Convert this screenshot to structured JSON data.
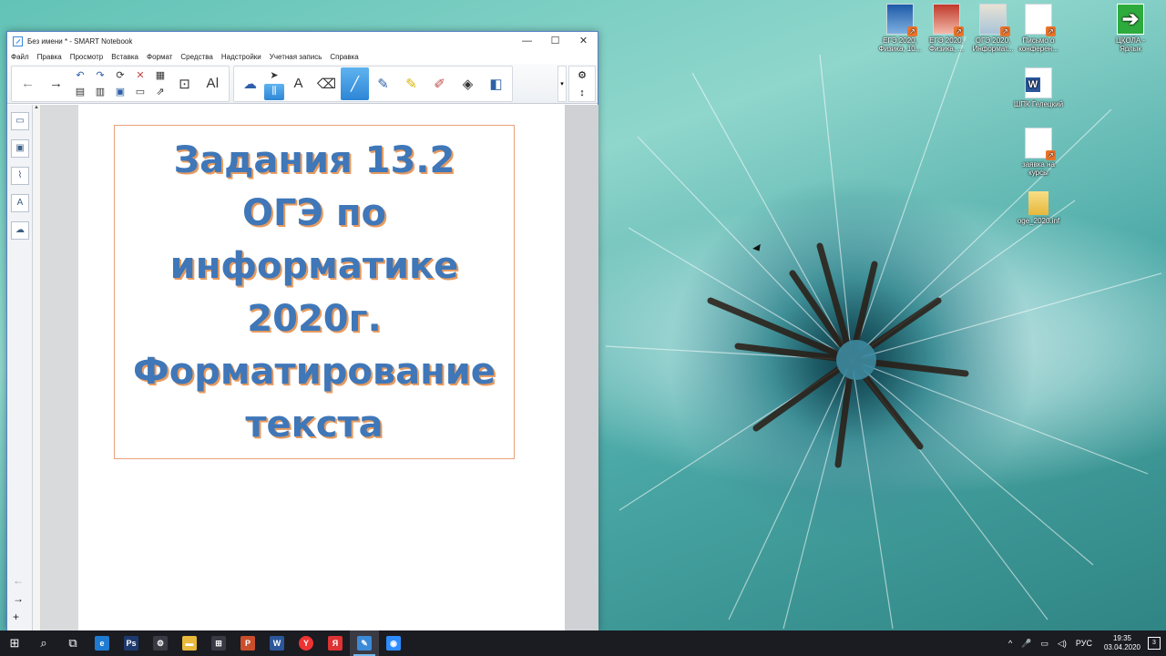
{
  "desktop": {
    "icons": [
      {
        "label": "ЕГЭ 2020, Физика, 10...",
        "kind": "book"
      },
      {
        "label": "ЕГЭ 2020, Физика, ...",
        "kind": "book red"
      },
      {
        "label": "ОГЭ 2020, Информат...",
        "kind": "book ink"
      },
      {
        "label": "Письмо о конферен...",
        "kind": "doc"
      },
      {
        "label": "ЦКОЛА - Ярлык",
        "kind": "arrow"
      },
      {
        "label": "ШПК Гелецкий",
        "kind": "word"
      },
      {
        "label": "заявка на курсы",
        "kind": "doc"
      },
      {
        "label": "oge_2020.inf",
        "kind": "folder"
      }
    ]
  },
  "window": {
    "title": "Без имени * - SMART Notebook",
    "controls": {
      "minimize": "—",
      "maximize": "☐",
      "close": "✕"
    },
    "menu": [
      "Файл",
      "Правка",
      "Просмотр",
      "Вставка",
      "Формат",
      "Средства",
      "Надстройки",
      "Учетная запись",
      "Справка"
    ],
    "toolbar": {
      "back": "←",
      "forward": "→",
      "undo": "↶",
      "redo": "↷",
      "delete": "✕",
      "table": "▦",
      "screen": "⊡",
      "text_format": "Aǀ",
      "select": "➤",
      "text": "A",
      "eraser": "⌫",
      "pen": "╱",
      "creative_pen": "✎",
      "highlighter": "✎",
      "magic_pen": "✐",
      "fill": "◈",
      "shapes": "◧",
      "settings": "⚙",
      "move": "↕",
      "more": "▾"
    },
    "side_tabs": [
      "▭",
      "▣",
      "⌇",
      "A",
      "☁"
    ],
    "side_nav": {
      "up": "←",
      "next": "→",
      "add": "+"
    },
    "slide": {
      "title_lines": [
        "Задания 13.2",
        "ОГЭ по",
        "информатике",
        "2020г.",
        "Форматирование",
        "текста"
      ]
    }
  },
  "taskbar": {
    "start": "⊞",
    "search": "⌕",
    "task_view": "⧉",
    "apps": [
      {
        "name": "edge",
        "glyph": "e",
        "color": "#1f7bd1"
      },
      {
        "name": "photoshop",
        "glyph": "Ps",
        "color": "#1d3a6e"
      },
      {
        "name": "tool",
        "glyph": "⚙",
        "color": "#3a3a44"
      },
      {
        "name": "explorer",
        "glyph": "▬",
        "color": "#e8b93a"
      },
      {
        "name": "store",
        "glyph": "⊞",
        "color": "#3a3a44"
      },
      {
        "name": "powerpoint",
        "glyph": "P",
        "color": "#c94f2c"
      },
      {
        "name": "word",
        "glyph": "W",
        "color": "#2b579a"
      },
      {
        "name": "yandex",
        "glyph": "Y",
        "color": "#e33"
      },
      {
        "name": "yandex-browser",
        "glyph": "Я",
        "color": "#d33"
      },
      {
        "name": "smart-notebook",
        "glyph": "✎",
        "color": "#3b8ad8"
      },
      {
        "name": "zoom",
        "glyph": "◉",
        "color": "#2d8cff"
      }
    ],
    "tray": {
      "chevron": "^",
      "mic": "🎤",
      "network": "▭",
      "volume": "◁)",
      "lang": "РУС",
      "time": "19:35",
      "date": "03.04.2020",
      "notifications": "3"
    }
  }
}
